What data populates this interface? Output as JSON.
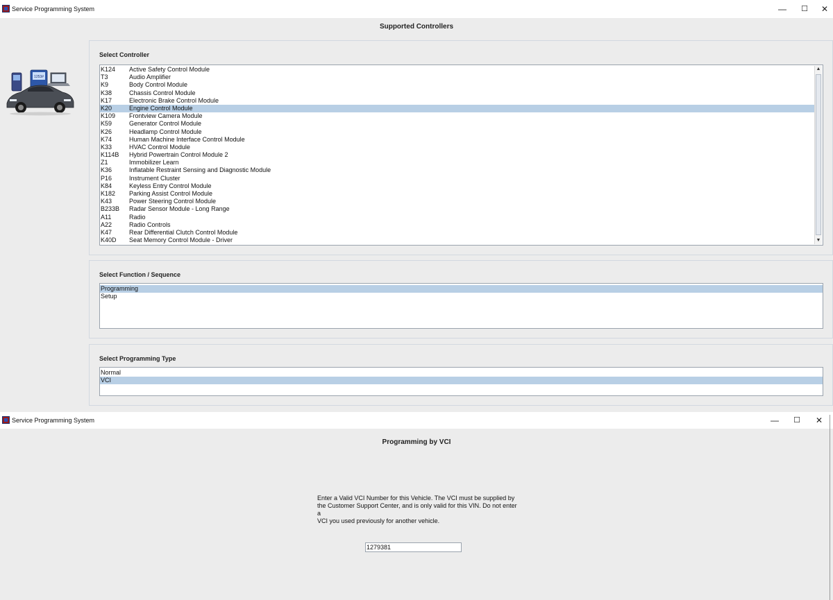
{
  "window1": {
    "title": "Service Programming System",
    "controls": {
      "minimize": "—",
      "maximize": "☐",
      "close": "✕"
    },
    "heading": "Supported Controllers",
    "select_controller": {
      "label": "Select Controller",
      "items": [
        {
          "code": "K124",
          "name": "Active Safety Control Module"
        },
        {
          "code": "T3",
          "name": "Audio Amplifier"
        },
        {
          "code": "K9",
          "name": "Body Control Module"
        },
        {
          "code": "K38",
          "name": "Chassis Control Module"
        },
        {
          "code": "K17",
          "name": "Electronic Brake Control Module"
        },
        {
          "code": "K20",
          "name": "Engine Control Module"
        },
        {
          "code": "K109",
          "name": "Frontview Camera Module"
        },
        {
          "code": "K59",
          "name": "Generator Control Module"
        },
        {
          "code": "K26",
          "name": "Headlamp Control Module"
        },
        {
          "code": "K74",
          "name": "Human Machine Interface Control Module"
        },
        {
          "code": "K33",
          "name": "HVAC Control Module"
        },
        {
          "code": "K114B",
          "name": "Hybrid Powertrain Control Module 2"
        },
        {
          "code": "Z1",
          "name": "Immobilizer Learn"
        },
        {
          "code": "K36",
          "name": "Inflatable Restraint Sensing and Diagnostic Module"
        },
        {
          "code": "P16",
          "name": "Instrument Cluster"
        },
        {
          "code": "K84",
          "name": "Keyless Entry Control Module"
        },
        {
          "code": "K182",
          "name": "Parking Assist Control Module"
        },
        {
          "code": "K43",
          "name": "Power Steering Control Module"
        },
        {
          "code": "B233B",
          "name": "Radar Sensor Module - Long Range"
        },
        {
          "code": "A11",
          "name": "Radio"
        },
        {
          "code": "A22",
          "name": "Radio Controls"
        },
        {
          "code": "K47",
          "name": "Rear Differential Clutch Control Module"
        },
        {
          "code": "K40D",
          "name": "Seat Memory Control Module - Driver"
        }
      ],
      "selected_index": 5
    },
    "select_function": {
      "label": "Select Function / Sequence",
      "items": [
        "Programming",
        "Setup"
      ],
      "selected_index": 0
    },
    "select_programming_type": {
      "label": "Select Programming Type",
      "items": [
        "Normal",
        "VCI"
      ],
      "selected_index": 1
    },
    "colors": {
      "selection": "#b8cfe5",
      "background": "#ececec"
    }
  },
  "window2": {
    "title": "Service Programming System",
    "controls": {
      "minimize": "—",
      "maximize": "☐",
      "close": "✕"
    },
    "heading": "Programming by VCI",
    "instruction_lines": [
      "Enter a Valid VCI Number for this Vehicle. The VCI must be supplied by",
      "the Customer Support Center, and is only valid for this VIN. Do not enter a",
      "VCI you used previously for another vehicle."
    ],
    "vci_input_value": "1279381"
  }
}
